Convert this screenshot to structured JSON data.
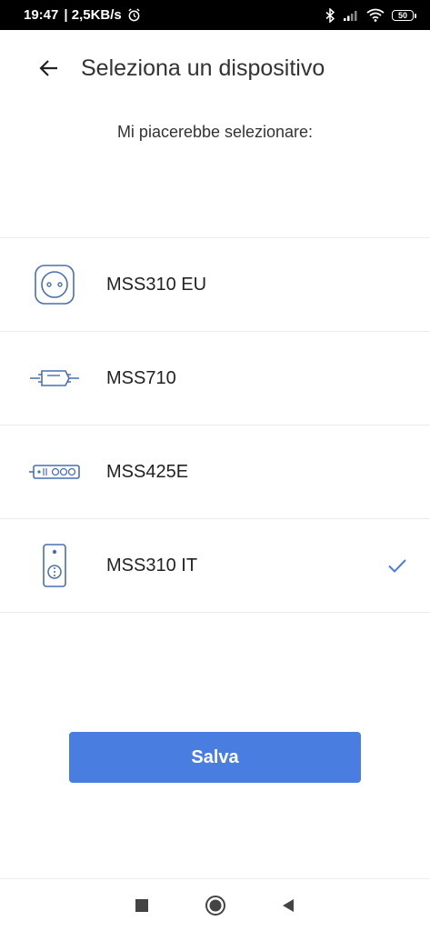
{
  "status_bar": {
    "time": "19:47",
    "speed": "| 2,5KB/s",
    "battery": "50"
  },
  "header": {
    "title": "Seleziona un dispositivo"
  },
  "subtitle": "Mi piacerebbe selezionare:",
  "devices": [
    {
      "label": "MSS310 EU",
      "icon": "eu-plug-icon",
      "selected": false
    },
    {
      "label": "MSS710",
      "icon": "inline-switch-icon",
      "selected": false
    },
    {
      "label": "MSS425E",
      "icon": "power-strip-icon",
      "selected": false
    },
    {
      "label": "MSS310 IT",
      "icon": "it-plug-icon",
      "selected": true
    }
  ],
  "save_button": {
    "label": "Salva"
  },
  "colors": {
    "accent": "#4a7de0",
    "icon_stroke": "#4a6fb0"
  }
}
